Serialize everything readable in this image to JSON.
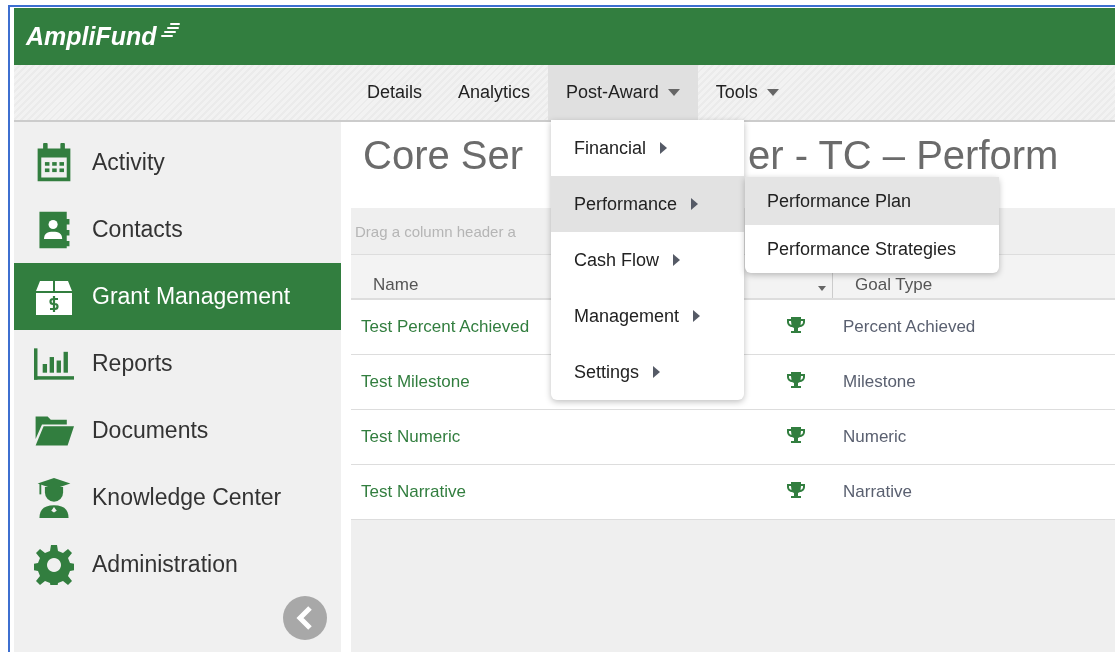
{
  "header": {
    "logo": "AmpliFund"
  },
  "nav": {
    "tabs": [
      {
        "label": "Details",
        "selected": false,
        "dropdown": false
      },
      {
        "label": "Analytics",
        "selected": false,
        "dropdown": false
      },
      {
        "label": "Post-Award",
        "selected": true,
        "dropdown": true
      },
      {
        "label": "Tools",
        "selected": false,
        "dropdown": true
      }
    ]
  },
  "sidebar": {
    "items": [
      {
        "label": "Activity",
        "selected": false
      },
      {
        "label": "Contacts",
        "selected": false
      },
      {
        "label": "Grant Management",
        "selected": true
      },
      {
        "label": "Reports",
        "selected": false
      },
      {
        "label": "Documents",
        "selected": false
      },
      {
        "label": "Knowledge Center",
        "selected": false
      },
      {
        "label": "Administration",
        "selected": false
      }
    ]
  },
  "page": {
    "title_parts": [
      "Core Ser",
      "er - TC – Perform"
    ]
  },
  "grid": {
    "group_hint": "Drag a column header a",
    "columns": [
      {
        "label": "Name"
      },
      {
        "label": "Goal Type"
      }
    ],
    "rows": [
      {
        "name": "Test Percent Achieved",
        "goal_type": "Percent Achieved"
      },
      {
        "name": "Test Milestone",
        "goal_type": "Milestone"
      },
      {
        "name": "Test Numeric",
        "goal_type": "Numeric"
      },
      {
        "name": "Test Narrative",
        "goal_type": "Narrative"
      }
    ]
  },
  "menu": {
    "items": [
      {
        "label": "Financial",
        "selected": false
      },
      {
        "label": "Performance",
        "selected": true
      },
      {
        "label": "Cash Flow",
        "selected": false
      },
      {
        "label": "Management",
        "selected": false
      },
      {
        "label": "Settings",
        "selected": false
      }
    ],
    "submenu": {
      "items": [
        {
          "label": "Performance Plan",
          "selected": true
        },
        {
          "label": "Performance Strategies",
          "selected": false
        }
      ]
    }
  }
}
